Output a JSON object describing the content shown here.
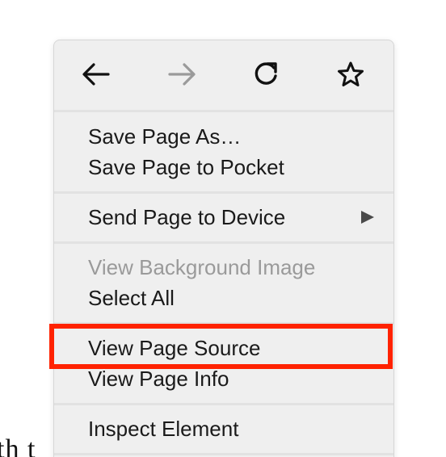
{
  "background": {
    "text": "th t"
  },
  "context_menu": {
    "nav": {
      "back_icon": "arrow-left-icon",
      "forward_icon": "arrow-right-icon",
      "reload_icon": "reload-icon",
      "bookmark_icon": "star-icon"
    },
    "items": [
      {
        "label": "Save Page As…",
        "enabled": true
      },
      {
        "label": "Save Page to Pocket",
        "enabled": true
      },
      {
        "label": "Send Page to Device",
        "enabled": true,
        "submenu": true
      },
      {
        "label": "View Background Image",
        "enabled": false
      },
      {
        "label": "Select All",
        "enabled": true
      },
      {
        "label": "View Page Source",
        "enabled": true,
        "highlighted": true
      },
      {
        "label": "View Page Info",
        "enabled": true
      },
      {
        "label": "Inspect Element",
        "enabled": true
      }
    ]
  },
  "colors": {
    "menu_background": "#efefef",
    "highlight": "#ff2200",
    "disabled_text": "#9a9a9a",
    "forward_disabled": "#9a9a9a"
  }
}
